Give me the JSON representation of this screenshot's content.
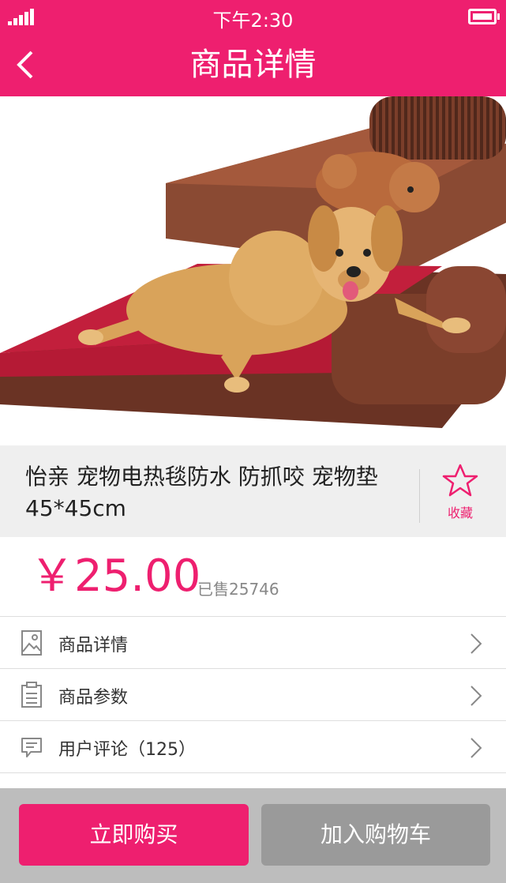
{
  "status_bar": {
    "time": "下午2:30"
  },
  "nav": {
    "title": "商品详情"
  },
  "product": {
    "title": "怡亲  宠物电热毯防水  防抓咬  宠物垫45*45cm",
    "favorite_label": "收藏",
    "price": "￥25.00",
    "sold": "已售25746"
  },
  "menu": [
    {
      "label": "商品详情",
      "icon": "image-icon"
    },
    {
      "label": "商品参数",
      "icon": "clipboard-icon"
    },
    {
      "label": "用户评论（125）",
      "icon": "comment-icon"
    }
  ],
  "actions": {
    "buy": "立即购买",
    "add_cart": "加入购物车"
  },
  "colors": {
    "accent": "#ee1f6f",
    "cart_button": "#9a9a9a",
    "title_bg": "#efefef"
  }
}
